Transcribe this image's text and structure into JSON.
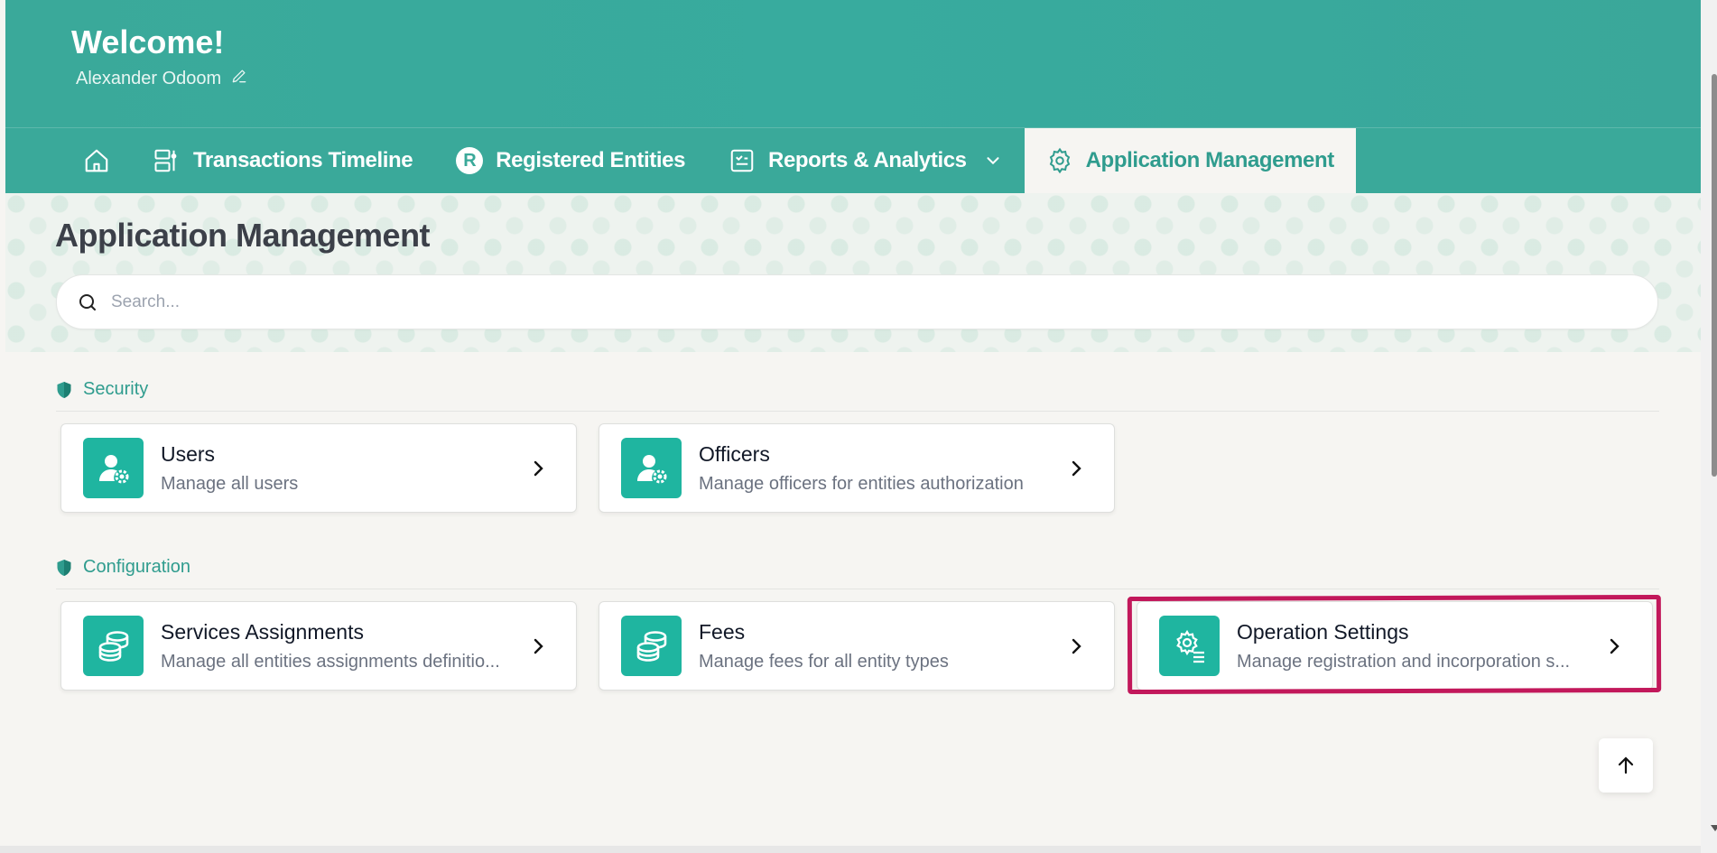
{
  "header": {
    "welcome": "Welcome!",
    "user_name": "Alexander Odoom",
    "edit_icon": "pencil-icon",
    "bg_color": "#3aa99a"
  },
  "nav": {
    "home_icon": "home-icon",
    "items": [
      {
        "label": "Transactions Timeline",
        "icon": "timeline-icon"
      },
      {
        "label": "Registered Entities",
        "icon": "r-badge-icon",
        "badge": "R"
      },
      {
        "label": "Reports & Analytics",
        "icon": "report-icon",
        "has_dropdown": true
      },
      {
        "label": "Application Management",
        "icon": "gear-icon",
        "active": true
      }
    ]
  },
  "page": {
    "title": "Application Management",
    "search_placeholder": "Search..."
  },
  "sections": [
    {
      "title": "Security",
      "icon": "shield-icon",
      "cards": [
        {
          "title": "Users",
          "subtitle": "Manage all users",
          "icon": "user-gear-icon"
        },
        {
          "title": "Officers",
          "subtitle": "Manage officers for entities authorization",
          "icon": "user-gear-icon"
        }
      ]
    },
    {
      "title": "Configuration",
      "icon": "shield-icon",
      "cards": [
        {
          "title": "Services Assignments",
          "subtitle": "Manage all entities assignments definitio...",
          "icon": "database-icon"
        },
        {
          "title": "Fees",
          "subtitle": "Manage fees for all entity types",
          "icon": "database-icon"
        },
        {
          "title": "Operation Settings",
          "subtitle": "Manage registration and incorporation s...",
          "icon": "gear-list-icon",
          "highlighted": true
        }
      ]
    }
  ],
  "colors": {
    "accent": "#1fb5a0",
    "header": "#3aa99a",
    "section_text": "#2f9c8e",
    "highlight": "#c2185b"
  }
}
